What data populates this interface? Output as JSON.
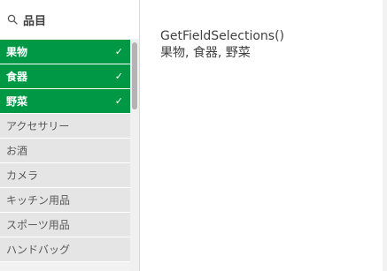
{
  "listbox": {
    "title": "品目",
    "items": [
      {
        "label": "果物",
        "selected": true
      },
      {
        "label": "食器",
        "selected": true
      },
      {
        "label": "野菜",
        "selected": true
      },
      {
        "label": "アクセサリー",
        "selected": false
      },
      {
        "label": "お酒",
        "selected": false
      },
      {
        "label": "カメラ",
        "selected": false
      },
      {
        "label": "キッチン用品",
        "selected": false
      },
      {
        "label": "スポーツ用品",
        "selected": false
      },
      {
        "label": "ハンドバッグ",
        "selected": false
      }
    ],
    "check_glyph": "✓"
  },
  "content": {
    "expression": "GetFieldSelections()",
    "result": "果物, 食器, 野菜"
  },
  "colors": {
    "selected": "#009845",
    "alternative": "#e5e5e5"
  }
}
